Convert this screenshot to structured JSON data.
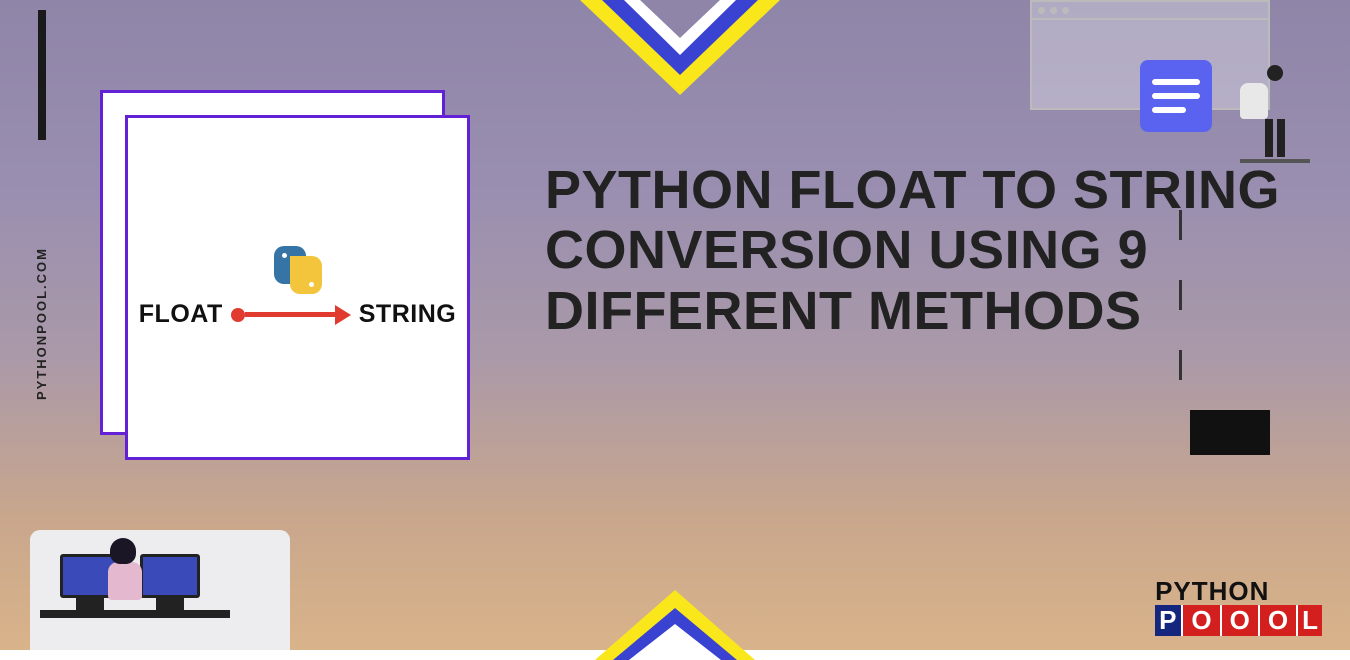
{
  "site_url": "PYTHONPOOL.COM",
  "card": {
    "left_label": "FLOAT",
    "right_label": "STRING"
  },
  "headline": "PYTHON FLOAT TO STRING CONVERSION USING 9 DIFFERENT METHODS",
  "brand": {
    "line1": "PYTHON",
    "prefix": "P",
    "middle_o": "O",
    "suffix": "L"
  }
}
